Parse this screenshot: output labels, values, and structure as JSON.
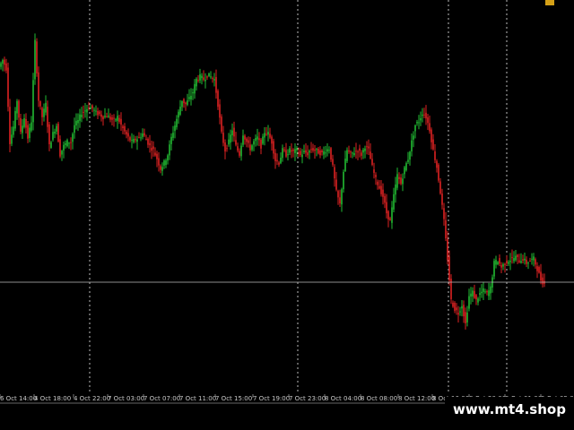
{
  "watermark": "www.mt4.shop",
  "colors": {
    "background": "#000000",
    "bull": "#22bb33",
    "bear": "#dd2222",
    "grid": "#bbbbbb",
    "price_line": "#bbbbbb",
    "text": "#c8c8c8"
  },
  "chart_data": {
    "type": "candlestick",
    "title": "",
    "xlabel": "",
    "ylabel": "",
    "ylim": [
      0,
      470
    ],
    "grid": "vertical dotted day separators",
    "x_tick_labels": [
      "6 Oct 14:00",
      "4 Oct 18:00",
      "4 Oct 22:00",
      "7 Oct 03:00",
      "7 Oct 07:00",
      "7 Oct 11:00",
      "7 Oct 15:00",
      "7 Oct 19:00",
      "7 Oct 23:00",
      "8 Oct 04:00",
      "8 Oct 08:00",
      "8 Oct 12:00",
      "8 Oct 16:00",
      "8 Oct 20:00",
      "9 Oct 01:00",
      "9 Oct 05:00"
    ],
    "day_separator_labels": [
      "4 Oct 22:00",
      "7 Oct 23:00",
      "8 Oct 16:00",
      "9 Oct 01:00"
    ],
    "current_price": 132,
    "close_path": [
      [
        0,
        390
      ],
      [
        4,
        398
      ],
      [
        8,
        388
      ],
      [
        12,
        300
      ],
      [
        16,
        318
      ],
      [
        20,
        350
      ],
      [
        24,
        310
      ],
      [
        28,
        330
      ],
      [
        32,
        305
      ],
      [
        36,
        325
      ],
      [
        40,
        420
      ],
      [
        44,
        350
      ],
      [
        48,
        330
      ],
      [
        52,
        345
      ],
      [
        56,
        295
      ],
      [
        60,
        310
      ],
      [
        64,
        320
      ],
      [
        68,
        285
      ],
      [
        72,
        295
      ],
      [
        76,
        300
      ],
      [
        80,
        300
      ],
      [
        84,
        320
      ],
      [
        88,
        325
      ],
      [
        92,
        335
      ],
      [
        96,
        338
      ],
      [
        100,
        342
      ],
      [
        104,
        340
      ],
      [
        108,
        335
      ],
      [
        112,
        333
      ],
      [
        116,
        330
      ],
      [
        120,
        332
      ],
      [
        124,
        328
      ],
      [
        128,
        325
      ],
      [
        132,
        330
      ],
      [
        136,
        320
      ],
      [
        140,
        312
      ],
      [
        144,
        305
      ],
      [
        148,
        300
      ],
      [
        152,
        303
      ],
      [
        156,
        305
      ],
      [
        160,
        310
      ],
      [
        164,
        303
      ],
      [
        168,
        295
      ],
      [
        172,
        290
      ],
      [
        176,
        280
      ],
      [
        180,
        268
      ],
      [
        184,
        275
      ],
      [
        188,
        285
      ],
      [
        192,
        305
      ],
      [
        196,
        320
      ],
      [
        200,
        335
      ],
      [
        204,
        350
      ],
      [
        208,
        345
      ],
      [
        212,
        352
      ],
      [
        216,
        360
      ],
      [
        220,
        375
      ],
      [
        224,
        378
      ],
      [
        228,
        375
      ],
      [
        232,
        380
      ],
      [
        236,
        378
      ],
      [
        240,
        375
      ],
      [
        244,
        345
      ],
      [
        248,
        310
      ],
      [
        252,
        290
      ],
      [
        256,
        300
      ],
      [
        260,
        315
      ],
      [
        264,
        295
      ],
      [
        268,
        285
      ],
      [
        272,
        310
      ],
      [
        276,
        300
      ],
      [
        280,
        292
      ],
      [
        284,
        300
      ],
      [
        288,
        305
      ],
      [
        292,
        295
      ],
      [
        296,
        312
      ],
      [
        300,
        310
      ],
      [
        304,
        300
      ],
      [
        308,
        278
      ],
      [
        312,
        275
      ],
      [
        316,
        290
      ],
      [
        320,
        285
      ],
      [
        324,
        290
      ],
      [
        328,
        288
      ],
      [
        332,
        290
      ],
      [
        336,
        284
      ],
      [
        340,
        288
      ],
      [
        344,
        286
      ],
      [
        348,
        292
      ],
      [
        352,
        290
      ],
      [
        356,
        288
      ],
      [
        360,
        286
      ],
      [
        364,
        290
      ],
      [
        368,
        292
      ],
      [
        372,
        270
      ],
      [
        376,
        240
      ],
      [
        380,
        225
      ],
      [
        384,
        265
      ],
      [
        388,
        290
      ],
      [
        392,
        285
      ],
      [
        396,
        288
      ],
      [
        400,
        290
      ],
      [
        404,
        285
      ],
      [
        408,
        295
      ],
      [
        412,
        290
      ],
      [
        416,
        270
      ],
      [
        420,
        255
      ],
      [
        424,
        245
      ],
      [
        428,
        235
      ],
      [
        432,
        215
      ],
      [
        436,
        205
      ],
      [
        440,
        235
      ],
      [
        444,
        260
      ],
      [
        448,
        250
      ],
      [
        452,
        268
      ],
      [
        456,
        280
      ],
      [
        460,
        300
      ],
      [
        464,
        320
      ],
      [
        468,
        325
      ],
      [
        472,
        335
      ],
      [
        476,
        330
      ],
      [
        480,
        315
      ],
      [
        484,
        290
      ],
      [
        488,
        270
      ],
      [
        492,
        240
      ],
      [
        496,
        205
      ],
      [
        500,
        160
      ],
      [
        504,
        110
      ],
      [
        508,
        100
      ],
      [
        512,
        95
      ],
      [
        516,
        105
      ],
      [
        520,
        82
      ],
      [
        524,
        115
      ],
      [
        528,
        120
      ],
      [
        532,
        110
      ],
      [
        536,
        118
      ],
      [
        540,
        122
      ],
      [
        544,
        118
      ],
      [
        548,
        125
      ],
      [
        552,
        155
      ],
      [
        556,
        158
      ],
      [
        560,
        150
      ],
      [
        564,
        155
      ],
      [
        568,
        158
      ],
      [
        572,
        160
      ],
      [
        576,
        162
      ],
      [
        580,
        158
      ],
      [
        584,
        160
      ],
      [
        588,
        155
      ],
      [
        592,
        158
      ],
      [
        596,
        160
      ],
      [
        600,
        148
      ],
      [
        604,
        135
      ],
      [
        608,
        130
      ]
    ]
  }
}
